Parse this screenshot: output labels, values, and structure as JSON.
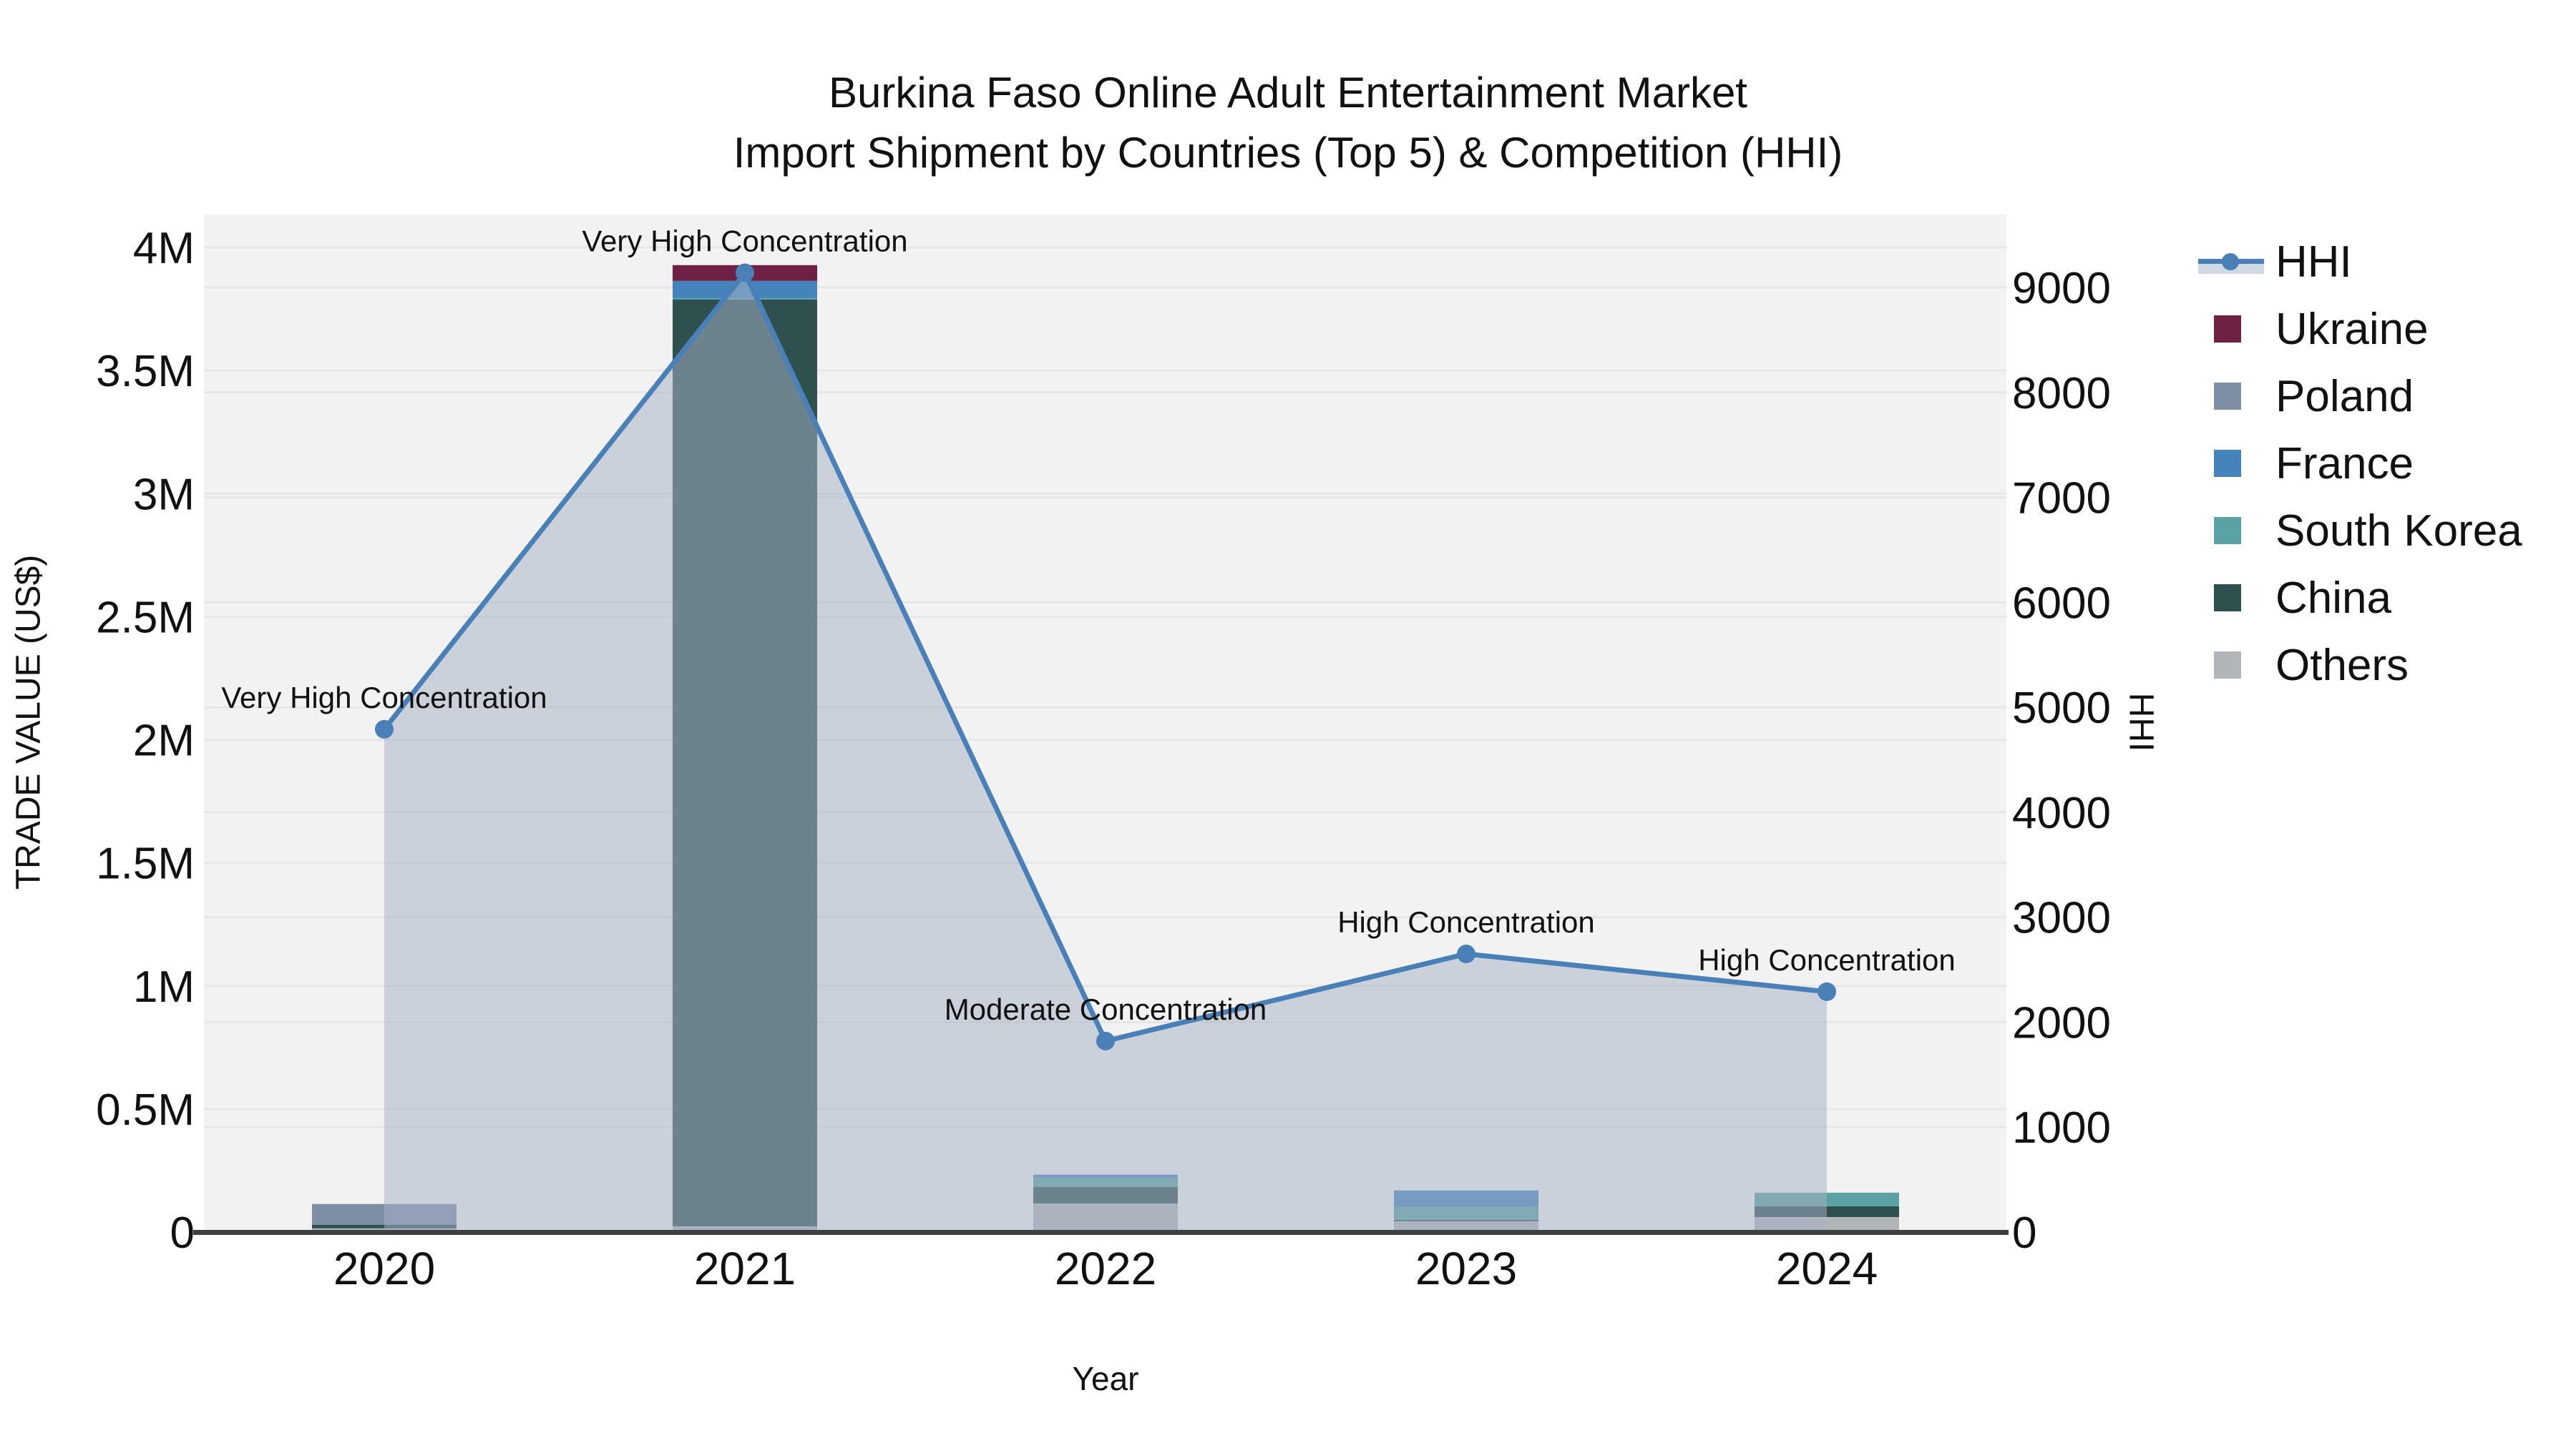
{
  "title": {
    "line1": "Burkina Faso Online Adult Entertainment Market",
    "line2": "Import Shipment by Countries (Top 5) & Competition (HHI)"
  },
  "axes": {
    "left_label": "TRADE VALUE (US$)",
    "right_label": "HHI",
    "x_label": "Year",
    "left_ticks": [
      {
        "label": "0",
        "value": 0
      },
      {
        "label": "0.5M",
        "value": 500000
      },
      {
        "label": "1M",
        "value": 1000000
      },
      {
        "label": "1.5M",
        "value": 1500000
      },
      {
        "label": "2M",
        "value": 2000000
      },
      {
        "label": "2.5M",
        "value": 2500000
      },
      {
        "label": "3M",
        "value": 3000000
      },
      {
        "label": "3.5M",
        "value": 3500000
      },
      {
        "label": "4M",
        "value": 4000000
      }
    ],
    "right_ticks": [
      {
        "label": "0",
        "value": 0
      },
      {
        "label": "1000",
        "value": 1000
      },
      {
        "label": "2000",
        "value": 2000
      },
      {
        "label": "3000",
        "value": 3000
      },
      {
        "label": "4000",
        "value": 4000
      },
      {
        "label": "5000",
        "value": 5000
      },
      {
        "label": "6000",
        "value": 6000
      },
      {
        "label": "7000",
        "value": 7000
      },
      {
        "label": "8000",
        "value": 8000
      },
      {
        "label": "9000",
        "value": 9000
      }
    ]
  },
  "colors": {
    "hhi_line": "#4a80b8",
    "hhi_area": "#a4b2c6",
    "ukraine": "#6e2142",
    "poland": "#7e8fa3",
    "france": "#4583bc",
    "south_korea": "#5aa2a3",
    "china": "#2e5150",
    "others": "#b2b5b7",
    "plot_bg": "#f2f2f2",
    "gridline": "#e6e6e6",
    "baseline": "#3d4043"
  },
  "legend": {
    "items": [
      {
        "label": "HHI",
        "type": "line",
        "color": "#4a80b8"
      },
      {
        "label": "Ukraine",
        "type": "square",
        "color": "#6e2142"
      },
      {
        "label": "Poland",
        "type": "square",
        "color": "#7e8fa3"
      },
      {
        "label": "France",
        "type": "square",
        "color": "#4583bc"
      },
      {
        "label": "South Korea",
        "type": "square",
        "color": "#5aa2a3"
      },
      {
        "label": "China",
        "type": "square",
        "color": "#2e5150"
      },
      {
        "label": "Others",
        "type": "square",
        "color": "#b2b5b7"
      }
    ]
  },
  "chart_data": {
    "type": "combo-stacked-bar-line",
    "title": "Burkina Faso Online Adult Entertainment Market — Import Shipment by Countries (Top 5) & Competition (HHI)",
    "categories": [
      "2020",
      "2021",
      "2022",
      "2023",
      "2024"
    ],
    "xlabel": "Year",
    "ylabel_left": "TRADE VALUE (US$)",
    "ylabel_right": "HHI",
    "ylim_left": [
      0,
      4000000
    ],
    "ylim_right": [
      0,
      9000
    ],
    "grid": true,
    "legend_position": "right",
    "bar_series_bottom_to_top": [
      {
        "name": "Others",
        "color": "#b2b5b7",
        "values": [
          15000,
          23000,
          116000,
          44000,
          61000
        ]
      },
      {
        "name": "China",
        "color": "#2e5150",
        "values": [
          15000,
          3765000,
          67000,
          6000,
          44000
        ]
      },
      {
        "name": "South Korea",
        "color": "#5aa2a3",
        "values": [
          0,
          6000,
          38000,
          52000,
          55000
        ]
      },
      {
        "name": "France",
        "color": "#4583bc",
        "values": [
          0,
          70000,
          12000,
          67000,
          0
        ]
      },
      {
        "name": "Poland",
        "color": "#7e8fa3",
        "values": [
          84000,
          0,
          0,
          0,
          0
        ]
      },
      {
        "name": "Ukraine",
        "color": "#6e2142",
        "values": [
          0,
          64000,
          0,
          0,
          0
        ]
      }
    ],
    "line_series": {
      "name": "HHI",
      "color": "#4a80b8",
      "area_color": "#a4b2c6",
      "values": [
        4790,
        9140,
        1820,
        2650,
        2290
      ]
    },
    "annotations": [
      {
        "category": "2020",
        "text": "Very High Concentration"
      },
      {
        "category": "2021",
        "text": "Very High Concentration"
      },
      {
        "category": "2022",
        "text": "Moderate Concentration"
      },
      {
        "category": "2023",
        "text": "High Concentration"
      },
      {
        "category": "2024",
        "text": "High Concentration"
      }
    ]
  }
}
